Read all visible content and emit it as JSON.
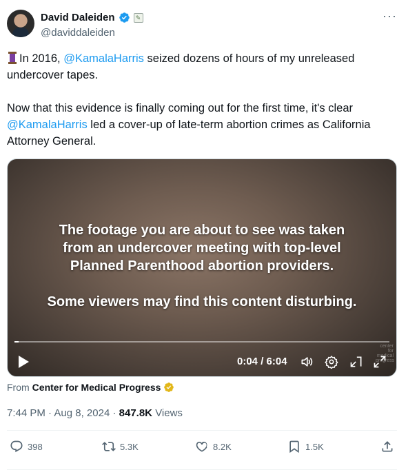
{
  "author": {
    "name": "David Daleiden",
    "handle": "@daviddaleiden"
  },
  "tweet": {
    "p1_prefix": "In 2016, ",
    "p1_mention": "@KamalaHarris",
    "p1_suffix": " seized dozens of hours of my unreleased undercover tapes.",
    "p2_prefix": "Now that this evidence is finally coming out for the first time, it's clear ",
    "p2_mention": "@KamalaHarris",
    "p2_suffix": " led a cover-up of late-term abortion crimes as California Attorney General."
  },
  "video": {
    "overlay_line1": "The footage you are about to see was taken from an undercover meeting with top-level Planned Parenthood abortion providers.",
    "overlay_line2": "Some viewers may find this content disturbing.",
    "time": "0:04 / 6:04",
    "progress": 0.011,
    "watermark": "center for medical progress"
  },
  "source": {
    "from_label": "From",
    "org": "Center for Medical Progress"
  },
  "meta": {
    "time": "7:44 PM",
    "sep": "·",
    "date": "Aug 8, 2024",
    "views_count": "847.8K",
    "views_label": "Views"
  },
  "actions": {
    "replies": "398",
    "reposts": "5.3K",
    "likes": "8.2K",
    "bookmarks": "1.5K"
  },
  "colors": {
    "accent": "#1d9bf0",
    "muted": "#536471",
    "gold": "#e2b719"
  }
}
